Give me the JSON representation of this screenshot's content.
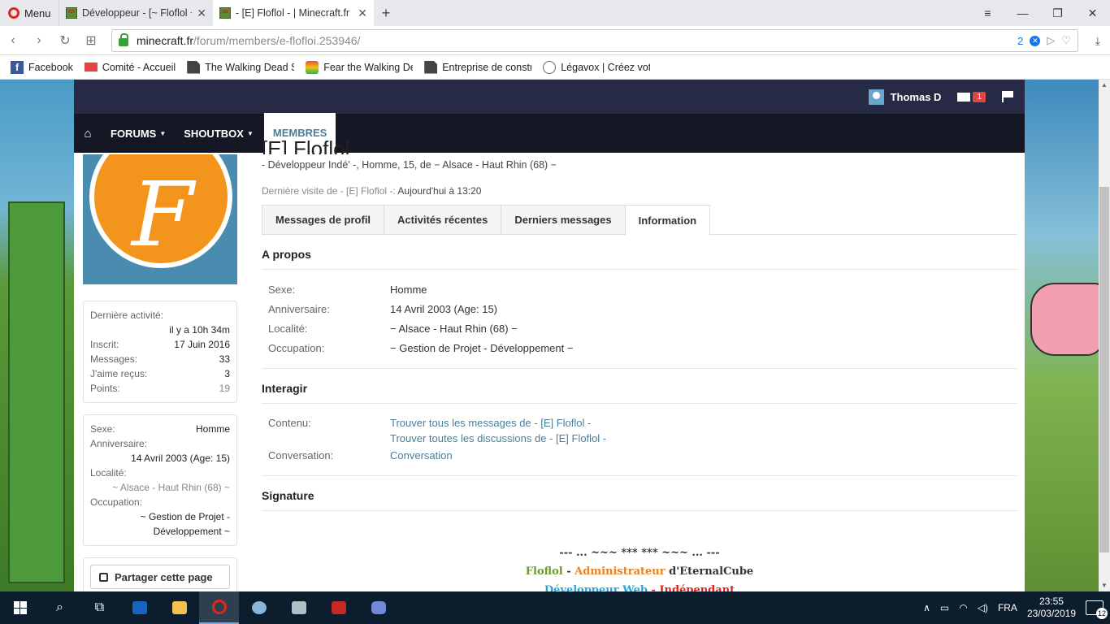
{
  "browser": {
    "menu_label": "Menu",
    "tabs": [
      {
        "title": "Développeur - [~ Floflol ~"
      },
      {
        "title": "- [E] Floflol - | Minecraft.fr"
      }
    ],
    "url_host": "minecraft.fr",
    "url_path": "/forum/members/e-flofloi.253946/",
    "adblock_count": "2",
    "bookmarks": [
      {
        "label": "Facebook"
      },
      {
        "label": "Comité - Accueil"
      },
      {
        "label": "The Walking Dead Sa"
      },
      {
        "label": "Fear the Walking Dea"
      },
      {
        "label": "Entreprise de constru"
      },
      {
        "label": "Légavox | Créez votre"
      }
    ]
  },
  "site": {
    "user_name": "Thomas D",
    "mail_count": "1",
    "nav": [
      {
        "label": "FORUMS"
      },
      {
        "label": "SHOUTBOX"
      },
      {
        "label": "MEMBRES"
      }
    ]
  },
  "profile": {
    "title": "[E] Floflol",
    "subtitle_prefix": "- Développeur Indé' -, Homme, 15, de ",
    "subtitle_place": "− Alsace - Haut Rhin (68) −",
    "last_visit_label": "Dernière visite de - [E] Floflol -:",
    "last_visit_value": "Aujourd'hui à 13:20",
    "tabs": [
      {
        "label": "Messages de profil"
      },
      {
        "label": "Activités récentes"
      },
      {
        "label": "Derniers messages"
      },
      {
        "label": "Information"
      }
    ],
    "stats": {
      "last_activity_label": "Dernière activité:",
      "last_activity_value": "il y a 10h 34m",
      "registered_label": "Inscrit:",
      "registered_value": "17 Juin 2016",
      "messages_label": "Messages:",
      "messages_value": "33",
      "likes_label": "J'aime reçus:",
      "likes_value": "3",
      "points_label": "Points:",
      "points_value": "19"
    },
    "side_info": {
      "sex_label": "Sexe:",
      "sex_value": "Homme",
      "birthday_label": "Anniversaire:",
      "birthday_value": "14 Avril 2003 (Age: 15)",
      "location_label": "Localité:",
      "location_value": "~ Alsace - Haut Rhin (68) ~",
      "occupation_label": "Occupation:",
      "occupation_value_1": "~ Gestion de Projet -",
      "occupation_value_2": "Développement ~"
    },
    "share_label": "Partager cette page",
    "about_heading": "A propos",
    "about": [
      {
        "k": "Sexe:",
        "v": "Homme"
      },
      {
        "k": "Anniversaire:",
        "v": "14 Avril 2003 (Age: 15)"
      },
      {
        "k": "Localité:",
        "v": "− Alsace - Haut Rhin (68) −"
      },
      {
        "k": "Occupation:",
        "v": "− Gestion de Projet - Développement −"
      }
    ],
    "interact_heading": "Interagir",
    "content_label": "Contenu:",
    "content_link_1": "Trouver tous les messages de - [E] Floflol -",
    "content_link_2": "Trouver toutes les discussions de - [E] Floflol -",
    "conversation_label": "Conversation:",
    "conversation_link": "Conversation",
    "signature_heading": "Signature",
    "signature_line1": "--- ... ~~~ *** *** ~~~ ... ---",
    "sig_name": "Floflol",
    "sig_sep": " - ",
    "sig_role": "Administrateur",
    "sig_org": " d'EternalCube",
    "sig_line3_a": "Développeur Web",
    "sig_line3_b": " - Indépendant"
  },
  "taskbar": {
    "lang": "FRA",
    "time": "23:55",
    "date": "23/03/2019",
    "notifications": "12"
  }
}
